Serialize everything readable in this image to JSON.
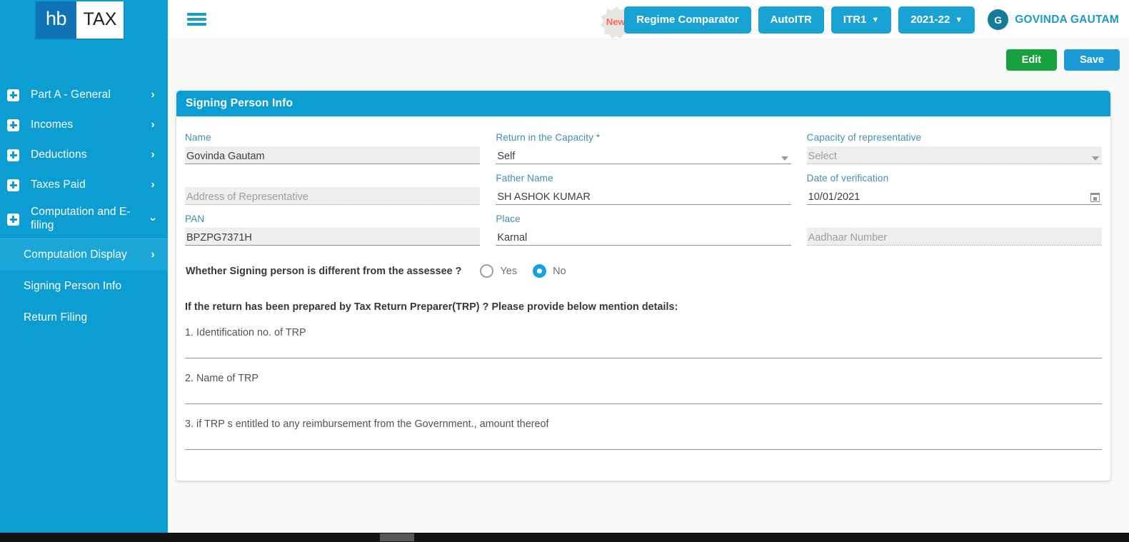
{
  "sidebar": {
    "logo": {
      "primary": "hb",
      "secondary": "TAX"
    },
    "items": [
      {
        "label": "Part A - General",
        "icon": "plus-icon",
        "chevron": "chevron-right-icon"
      },
      {
        "label": "Incomes",
        "icon": "plus-icon",
        "chevron": "chevron-right-icon"
      },
      {
        "label": "Deductions",
        "icon": "plus-icon",
        "chevron": "chevron-right-icon"
      },
      {
        "label": "Taxes Paid",
        "icon": "plus-icon",
        "chevron": "chevron-right-icon"
      },
      {
        "label": "Computation and E-filing",
        "icon": "plus-icon",
        "chevron": "chevron-down-icon"
      }
    ],
    "subitems": [
      {
        "label": "Computation Display",
        "chevron": "chevron-right-icon",
        "active": true
      },
      {
        "label": "Signing Person Info",
        "chevron": "",
        "active": false
      },
      {
        "label": "Return Filing",
        "chevron": "",
        "active": false
      }
    ]
  },
  "topbar": {
    "menu_icon": "hamburger-icon",
    "new_badge": "New",
    "regime_comparator": "Regime Comparator",
    "auto_itr": "AutoITR",
    "itr_form": "ITR1",
    "assessment_year": "2021-22",
    "user_initial": "G",
    "user_name": "GOVINDA GAUTAM"
  },
  "actions": {
    "edit": "Edit",
    "save": "Save"
  },
  "card": {
    "title": "Signing Person Info",
    "fields": [
      {
        "label": "Name",
        "value": "Govinda  Gautam",
        "state": "filled"
      },
      {
        "label": "Return in the Capacity *",
        "value": "Self",
        "state": "plain",
        "control": "dropdown"
      },
      {
        "label": "Capacity of representative",
        "value": "Select",
        "state": "disabled",
        "control": "dropdown"
      },
      {
        "label": "",
        "value": "",
        "state": "hidden"
      },
      {
        "label": "Father Name",
        "value": "SH ASHOK KUMAR",
        "state": "plain"
      },
      {
        "label": "Date of verification",
        "value": "10/01/2021",
        "state": "plain",
        "control": "calendar"
      },
      {
        "label": "",
        "value": "Address of Representative",
        "state": "disabled"
      },
      {
        "label": "Place",
        "value": "Karnal",
        "state": "plain"
      },
      {
        "label": "",
        "value": "Aadhaar Number",
        "state": "disabled"
      },
      {
        "label": "PAN",
        "value": "BPZPG7371H",
        "state": "filled"
      },
      {
        "label": "",
        "value": "",
        "state": "hidden"
      },
      {
        "label": "",
        "value": "",
        "state": "hidden"
      }
    ],
    "radio": {
      "question": "Whether Signing person is different from the assessee ?",
      "options": [
        {
          "label": "Yes",
          "checked": false
        },
        {
          "label": "No",
          "checked": true
        }
      ]
    },
    "trp": {
      "heading": "If the return has been prepared by Tax Return Preparer(TRP) ? Please provide below mention details:",
      "items": [
        "1. Identification no. of TRP",
        "2. Name of TRP",
        "3. if TRP s entitled to any reimbursement from the Government., amount thereof"
      ]
    }
  },
  "colors": {
    "brand_cyan": "#0c9dd2",
    "accent_blue": "#19a3d4",
    "success_green": "#18a23f",
    "label_blue": "#3f8fb5",
    "badge_red": "#ef6a5a",
    "avatar_teal": "#147a9e"
  }
}
